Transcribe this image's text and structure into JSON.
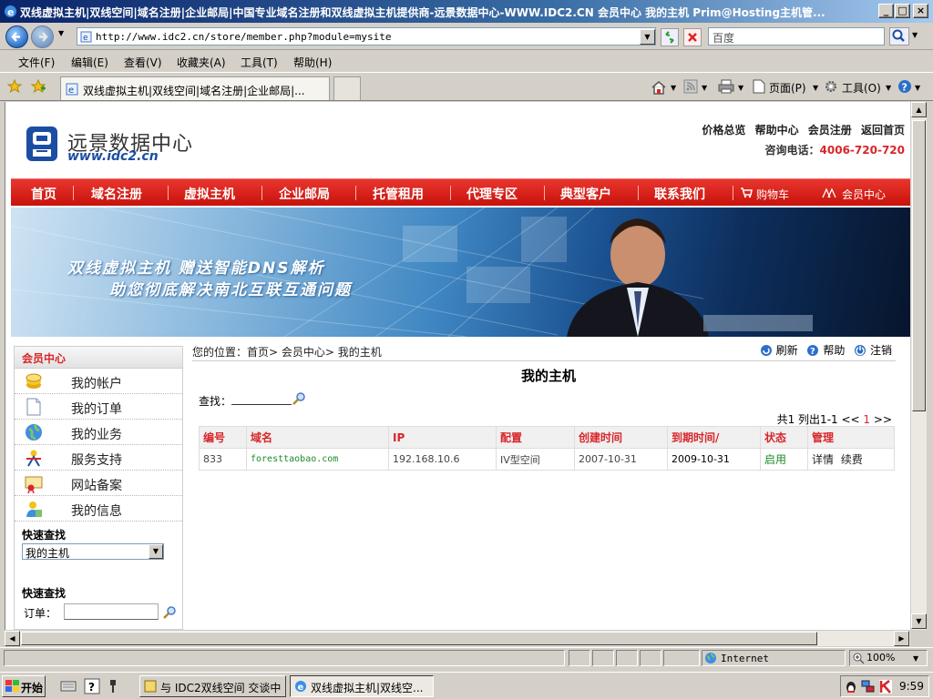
{
  "window": {
    "title": "双线虚拟主机|双线空间|域名注册|企业邮局|中国专业域名注册和双线虚拟主机提供商-远景数据中心-WWW.IDC2.CN 会员中心 我的主机 Prim@Hosting主机管..."
  },
  "browser": {
    "address": "http://www.idc2.cn/store/member.php?module=mysite",
    "search_placeholder": "百度",
    "menu": [
      "文件(F)",
      "编辑(E)",
      "查看(V)",
      "收藏夹(A)",
      "工具(T)",
      "帮助(H)"
    ],
    "tab_title": "双线虚拟主机|双线空间|域名注册|企业邮局|...",
    "toolbar_page": "页面(P)",
    "toolbar_tools": "工具(O)",
    "status_zone": "Internet",
    "zoom": "100%"
  },
  "site": {
    "logo_text": "远景数据中心",
    "logo_url": "www.idc2.cn",
    "top_links": [
      "价格总览",
      "帮助中心",
      "会员注册",
      "返回首页"
    ],
    "hotline_label": "咨询电话：",
    "hotline_number": "4006-720-720",
    "nav": [
      "首页",
      "域名注册",
      "虚拟主机",
      "企业邮局",
      "托管租用",
      "代理专区",
      "典型客户",
      "联系我们",
      "购物车",
      "会员中心"
    ],
    "banner_line1": "双线虚拟主机 赠送智能DNS解析",
    "banner_line2": "助您彻底解决南北互联互通问题"
  },
  "sidebar": {
    "header": "会员中心",
    "items": [
      {
        "label": "我的帐户",
        "icon": "coins-icon"
      },
      {
        "label": "我的订单",
        "icon": "document-icon"
      },
      {
        "label": "我的业务",
        "icon": "globe-icon"
      },
      {
        "label": "服务支持",
        "icon": "support-icon"
      },
      {
        "label": "网站备案",
        "icon": "certificate-icon"
      },
      {
        "label": "我的信息",
        "icon": "user-icon"
      }
    ],
    "quick_find_1": "快速查找",
    "quick_select": "我的主机",
    "quick_find_2": "快速查找",
    "order_label": "订单："
  },
  "main": {
    "breadcrumb": "您的位置：首页> 会员中心> 我的主机",
    "actions": [
      "刷新",
      "帮助",
      "注销"
    ],
    "title": "我的主机",
    "search_label": "查找：",
    "pager_text": "共1 列出1-1 <<",
    "pager_current": "1",
    "pager_next": ">>",
    "columns": [
      "编号",
      "域名",
      "IP",
      "配置",
      "创建时间",
      "到期时间/",
      "状态",
      "管理"
    ],
    "rows": [
      {
        "id": "833",
        "domain": "foresttaobao.com",
        "ip": "192.168.10.6",
        "config": "IV型空间",
        "created": "2007-10-31",
        "expires": "2009-10-31",
        "status": "启用",
        "manage_detail": "详情",
        "manage_renew": "续费"
      }
    ]
  },
  "taskbar": {
    "start": "开始",
    "tasks": [
      "与 IDC2双线空间 交谈中",
      "双线虚拟主机|双线空..."
    ],
    "clock": "9:59"
  },
  "colors": {
    "accent_red": "#d8262a",
    "link_green": "#1a8a2a",
    "title_blue": "#0a246a"
  }
}
